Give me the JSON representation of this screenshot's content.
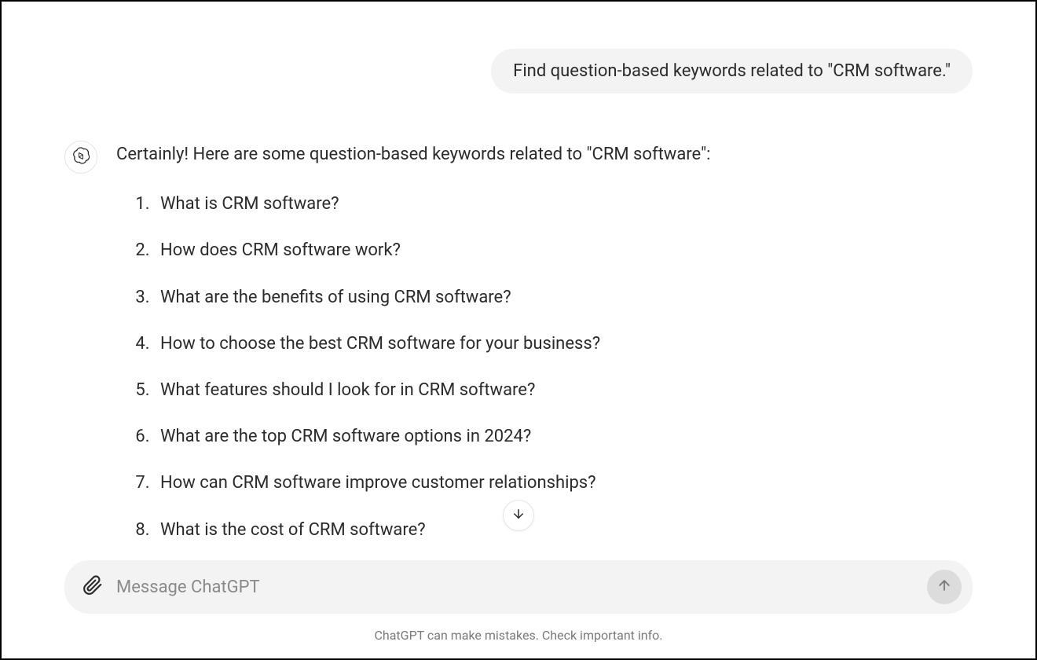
{
  "user_message": "Find question-based keywords related to \"CRM software.\"",
  "assistant": {
    "intro": "Certainly! Here are some question-based keywords related to \"CRM software\":",
    "items": [
      "What is CRM software?",
      "How does CRM software work?",
      "What are the benefits of using CRM software?",
      "How to choose the best CRM software for your business?",
      "What features should I look for in CRM software?",
      "What are the top CRM software options in 2024?",
      "How can CRM software improve customer relationships?",
      "What is the cost of CRM software?"
    ]
  },
  "input": {
    "placeholder": "Message ChatGPT",
    "value": ""
  },
  "disclaimer": "ChatGPT can make mistakes. Check important info."
}
